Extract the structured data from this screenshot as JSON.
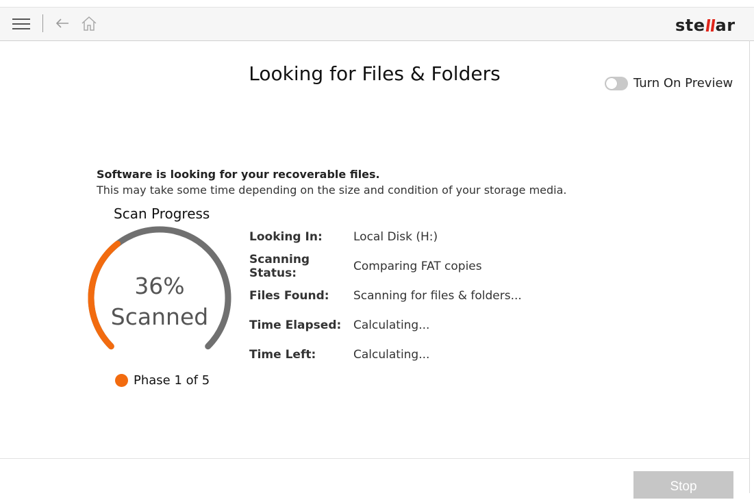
{
  "toolbar": {
    "brand": "stellar",
    "brand_parts": {
      "left": "ste",
      "right": "ar"
    }
  },
  "page": {
    "title": "Looking for Files & Folders"
  },
  "preview": {
    "label": "Turn On Preview",
    "enabled": false
  },
  "info": {
    "headline": "Software is looking for your recoverable files.",
    "subline": "This may take some time depending on the size and condition of your storage media."
  },
  "scan": {
    "title": "Scan Progress",
    "percent_text": "36%",
    "scanned_word": "Scanned",
    "progress": 0.36,
    "phase_text": "Phase 1 of 5"
  },
  "details": [
    {
      "label": "Looking In:",
      "value": "Local Disk (H:)"
    },
    {
      "label": "Scanning Status:",
      "value": "Comparing FAT copies"
    },
    {
      "label": "Files Found:",
      "value": "Scanning for files & folders..."
    },
    {
      "label": "Time Elapsed:",
      "value": "Calculating..."
    },
    {
      "label": "Time Left:",
      "value": "Calculating..."
    }
  ],
  "actions": {
    "stop_label": "Stop"
  },
  "colors": {
    "accent": "#f26b0f",
    "brand_red": "#e0261b",
    "gauge_track": "#707070",
    "button_disabled": "#c6c6c6"
  },
  "icons": {
    "menu": "hamburger-icon",
    "back": "back-arrow-icon",
    "home": "home-icon"
  }
}
